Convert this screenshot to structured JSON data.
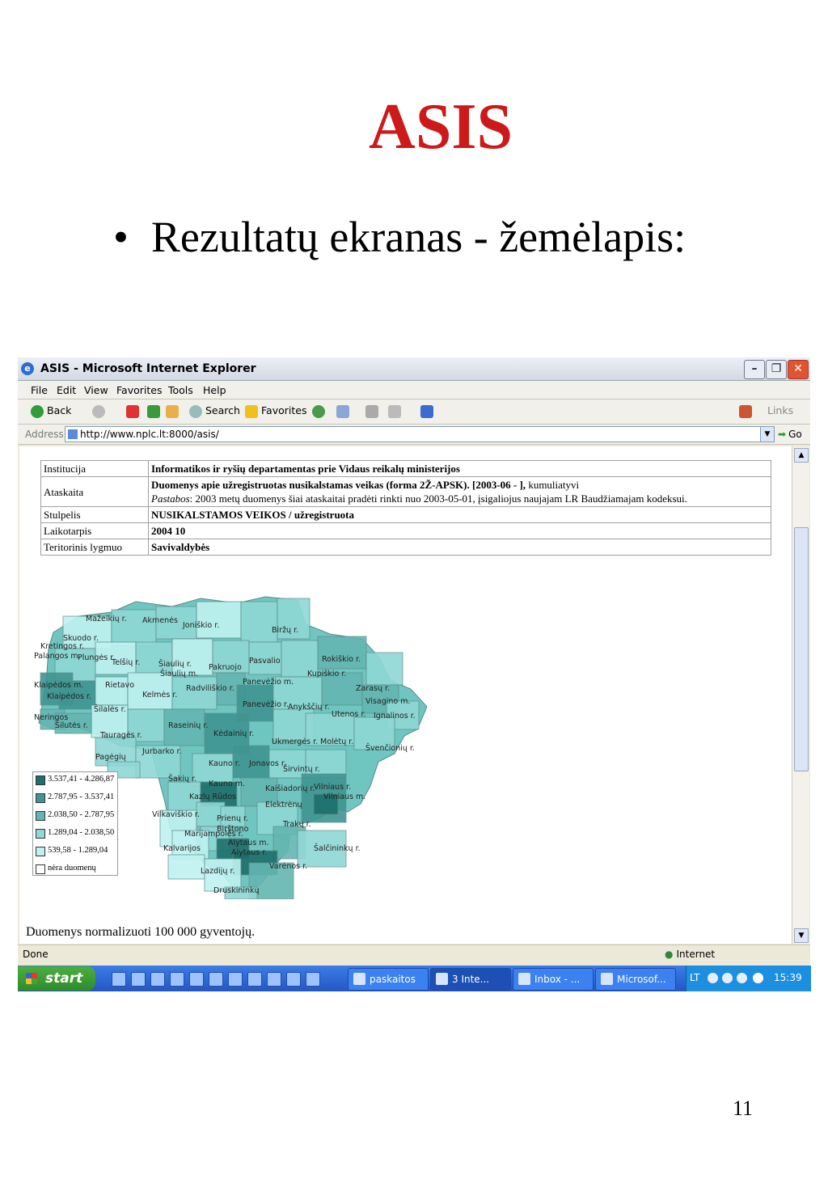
{
  "slide": {
    "title": "ASIS",
    "bullet_mark": "•",
    "bullet_text": "Rezultatų ekranas - žemėlapis:",
    "page_number": "11"
  },
  "window": {
    "title": "ASIS - Microsoft Internet Explorer",
    "menu": [
      "File",
      "Edit",
      "View",
      "Favorites",
      "Tools",
      "Help"
    ],
    "toolbar": {
      "back": "Back",
      "search": "Search",
      "favorites": "Favorites",
      "links": "Links"
    },
    "address_label": "Address",
    "url": "http://www.nplc.lt:8000/asis/",
    "go_label": "Go",
    "status": "Done",
    "zone": "Internet"
  },
  "report": {
    "rows": [
      {
        "key": "Institucija",
        "value": "Informatikos ir ryšių departamentas prie Vidaus reikalų ministerijos"
      },
      {
        "key": "Ataskaita",
        "value": "Duomenys apie užregistruotas nusikalstamas veikas (forma 2Ž-APSK). [2003-06 - ],",
        "suffix": " kumuliatyvi",
        "note_label": "Pastabos",
        "note": ": 2003 metų duomenys šiai ataskaitai pradėti rinkti nuo 2003-05-01, įsigaliojus naujajam LR Baudžiamajam kodeksui."
      },
      {
        "key": "Stulpelis",
        "value": "NUSIKALSTAMOS VEIKOS / užregistruota"
      },
      {
        "key": "Laikotarpis",
        "value": "2004 10"
      },
      {
        "key": "Teritorinis lygmuo",
        "value": "Savivaldybės"
      }
    ]
  },
  "legend": [
    {
      "label": "3.537,41 - 4.286,87",
      "color": "#1d6f6c"
    },
    {
      "label": "2.787,95 - 3.537,41",
      "color": "#3f9591"
    },
    {
      "label": "2.038,50 - 2.787,95",
      "color": "#63b6b1"
    },
    {
      "label": "1.289,04 - 2.038,50",
      "color": "#8fd8d4"
    },
    {
      "label": "539,58 - 1.289,04",
      "color": "#bff2f0"
    },
    {
      "label": "nėra duomenų",
      "color": "#ffffff"
    }
  ],
  "map_labels": [
    "Mažeikių r.",
    "Akmenės",
    "Joniškio r.",
    "Biržų r.",
    "Skuodo r.",
    "Kretingos r.",
    "Palangos m.",
    "Plungės r.",
    "Telšių r.",
    "Šiaulių r.",
    "Šiaulių m.",
    "Pakruojo",
    "Pasvalio",
    "Rokiškio r.",
    "Kupiškio r.",
    "Klaipėdos m.",
    "Klaipėdos r.",
    "Rietavo",
    "Kelmės r.",
    "Radviliškio r.",
    "Panevėžio m.",
    "Panevėžio r.",
    "Zarasų r.",
    "Visagino m.",
    "Anykščių r.",
    "Utenos r.",
    "Ignalinos r.",
    "Šilalės r.",
    "Neringos",
    "Šilutės r.",
    "Raseinių r.",
    "Kėdainių r.",
    "Tauragės r.",
    "Jurbarko r.",
    "Molėtų r.",
    "Ukmergės r.",
    "Švenčionių r.",
    "Pagėgių",
    "Kauno r.",
    "Jonavos r.",
    "Širvintų r.",
    "Šakių r.",
    "Kauno m.",
    "Kaišiadorių r.",
    "Vilniaus r.",
    "Vilniaus m.",
    "Kazlų Rūdos",
    "Elektrėnų",
    "Vilkaviškio r.",
    "Prienų r.",
    "Birštono",
    "Marijampolės r.",
    "Trakų r.",
    "Alytaus m.",
    "Alytaus r.",
    "Kalvarijos",
    "Šalčininkų r.",
    "Lazdijų r.",
    "Varėnos r.",
    "Druskininkų"
  ],
  "footnote": "Duomenys normalizuoti 100 000 gyventojų.",
  "taskbar": {
    "start": "start",
    "tasks": [
      "paskaitos",
      "3 Inte...",
      "Inbox - ...",
      "Microsof..."
    ],
    "lang": "LT",
    "clock": "15:39"
  }
}
